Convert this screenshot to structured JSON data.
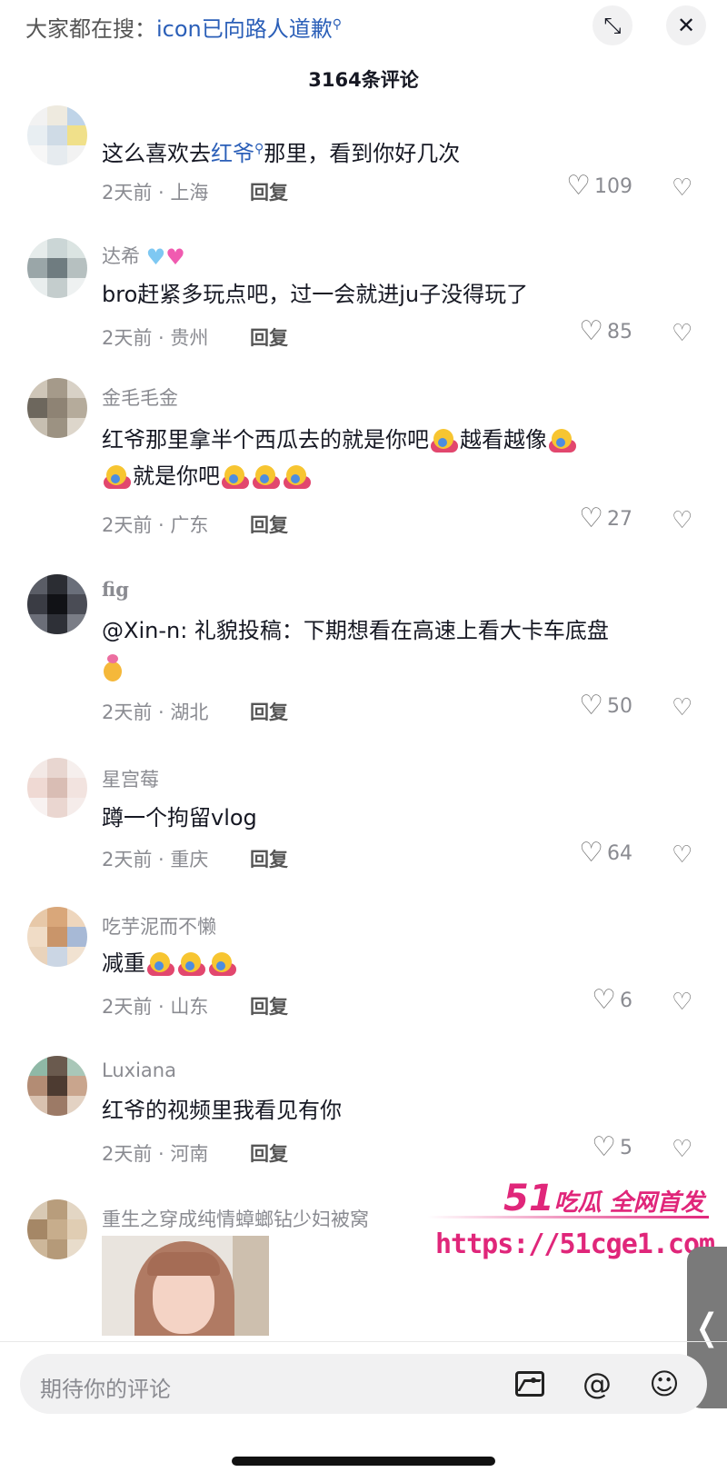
{
  "header": {
    "search_prefix": "大家都在搜：",
    "search_keyword": "icon已向路人道歉",
    "comment_count": "3164条评论"
  },
  "comments": [
    {
      "username": "",
      "text_before": "这么喜欢去",
      "keyword": "红爷",
      "text_after": "那里，看到你好几次",
      "time_location": "2天前 · 上海",
      "reply": "回复",
      "likes": "109",
      "avatar_colors": [
        "#f2f2f2",
        "#eeeadf",
        "#bfd4e8",
        "#e8eef2",
        "#cfdbe6",
        "#f0e08a",
        "#f7f7f7",
        "#e6ebef",
        "#f2f2f2"
      ]
    },
    {
      "username": "达希",
      "text": "bro赶紧多玩点吧，过一会就进ju子没得玩了",
      "time_location": "2天前 · 贵州",
      "reply": "回复",
      "likes": "85",
      "avatar_colors": [
        "#e6eceb",
        "#cbd6d6",
        "#dbe4e2",
        "#9aa6a8",
        "#6f7c80",
        "#b6c0c0",
        "#e9eeee",
        "#c4cdcd",
        "#eef1f1"
      ]
    },
    {
      "username": "金毛毛金",
      "text_line1": "红爷那里拿半个西瓜去的就是你吧",
      "text_mid": "越看越像",
      "text_line2": "就是你吧",
      "time_location": "2天前 · 广东",
      "reply": "回复",
      "likes": "27",
      "avatar_colors": [
        "#cfc6b8",
        "#a59a8a",
        "#d8d1c6",
        "#6d675d",
        "#8e8374",
        "#b5ab9b",
        "#c7bfb1",
        "#9c9282",
        "#ddd6cb"
      ]
    },
    {
      "username": "fig",
      "text": "@Xin-n: 礼貌投稿：下期想看在高速上看大卡车底盘",
      "time_location": "2天前 · 湖北",
      "reply": "回复",
      "likes": "50",
      "avatar_colors": [
        "#5a5d66",
        "#2b2d33",
        "#6a6f7a",
        "#3a3c44",
        "#111216",
        "#4a4c55",
        "#6b6e78",
        "#2e3037",
        "#7a7d86"
      ]
    },
    {
      "username": "星宫莓",
      "text": "蹲一个拘留vlog",
      "time_location": "2天前 · 重庆",
      "reply": "回复",
      "likes": "64",
      "avatar_colors": [
        "#f3e9e6",
        "#e8d6d0",
        "#f6efed",
        "#efd9d3",
        "#d9bdb4",
        "#f2e3df",
        "#f8f2f1",
        "#ead6d0",
        "#f5ecea"
      ]
    },
    {
      "username": "吃芋泥而不懒",
      "text": "减重",
      "time_location": "2天前 · 山东",
      "reply": "回复",
      "likes": "6",
      "avatar_colors": [
        "#e7c8a8",
        "#d9a77a",
        "#eed6bd",
        "#f0dcc6",
        "#c9956a",
        "#a7b9d6",
        "#e9d3bb",
        "#cbd6e4",
        "#f1e2d1"
      ]
    },
    {
      "username": "Luxiana",
      "text": "红爷的视频里我看见有你",
      "time_location": "2天前 · 河南",
      "reply": "回复",
      "likes": "5",
      "avatar_colors": [
        "#8fb8a6",
        "#6a5a4e",
        "#a9c7b8",
        "#b38c74",
        "#4d3b31",
        "#c9a58d",
        "#d9c2b0",
        "#9c7a66",
        "#e3d2c3"
      ]
    },
    {
      "username": "重生之穿成纯情蟑螂钻少妇被窝",
      "avatar_colors": [
        "#d8c9b4",
        "#b89d7c",
        "#e3d6c4",
        "#a58766",
        "#c7ad8c",
        "#e0cdb3",
        "#cdb79a",
        "#b59a79",
        "#e8dccb"
      ]
    }
  ],
  "watermark": {
    "brand_num": "51",
    "brand_text": "吃瓜 全网首发",
    "url": "https://51cge1.com"
  },
  "input": {
    "placeholder": "期待你的评论"
  },
  "icons": {
    "collapse": "collapse-icon",
    "close": "close-icon",
    "heart": "heart-icon",
    "dislike": "broken-heart-icon",
    "image": "image-icon",
    "at": "at-icon",
    "emoji": "emoji-icon"
  }
}
